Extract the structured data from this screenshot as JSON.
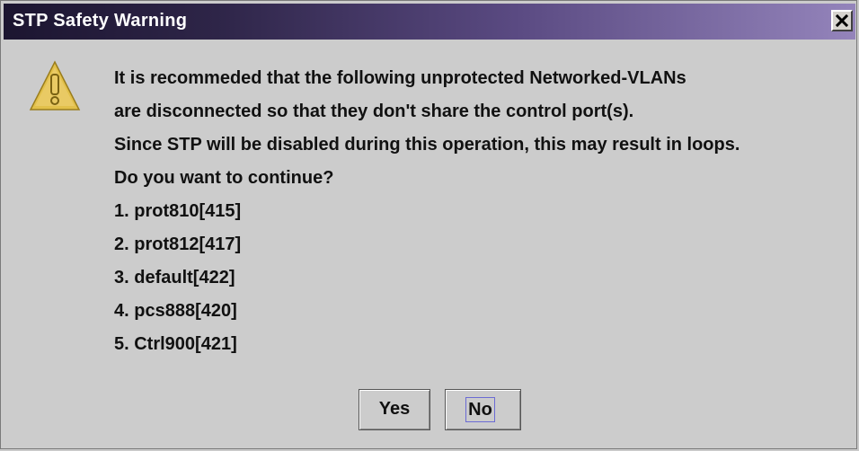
{
  "window": {
    "title": "STP Safety Warning",
    "close_symbol": "×"
  },
  "icons": {
    "warning": "warning-triangle-icon",
    "close": "close-icon"
  },
  "message": {
    "lines": [
      "It is recommeded that the following unprotected Networked-VLANs",
      "are disconnected so that they don't share the control port(s).",
      "Since STP will be disabled during this operation, this may result in loops.",
      "Do you want to continue?",
      "1. prot810[415]",
      "2. prot812[417]",
      "3. default[422]",
      "4. pcs888[420]",
      "5. Ctrl900[421]"
    ]
  },
  "buttons": {
    "yes_label": "Yes",
    "no_label": "No",
    "focused": "No"
  },
  "colors": {
    "title_gradient_start": "#1c1530",
    "title_gradient_end": "#9484bb",
    "dialog_background": "#cccccc",
    "warning_yellow": "#e2c04a",
    "focus_border": "#6b6bd4"
  }
}
